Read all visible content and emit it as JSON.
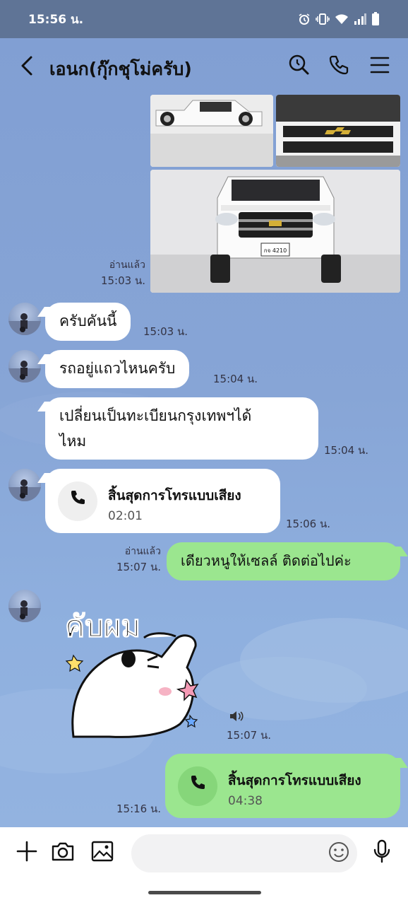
{
  "status_bar": {
    "time": "15:56 น."
  },
  "header": {
    "title": "เอนก(กุ๊กชุโม่ครับ)"
  },
  "messages": {
    "photos_read": "อ่านแล้ว",
    "photos_time": "15:03 น.",
    "plate_text": "กจ 4210",
    "msg1_text": "ครับคันนี้",
    "msg1_time": "15:03 น.",
    "msg2_text": "รถอยู่แถวไหนครับ",
    "msg2_time": "15:04 น.",
    "msg3_line1": "เปลี่ยนเป็นทะเบียนกรุงเทพฯได้",
    "msg3_line2": "ไหม",
    "msg3_time": "15:04 น.",
    "call1_title": "สิ้นสุดการโทรแบบเสียง",
    "call1_duration": "02:01",
    "call1_time": "15:06 น.",
    "reply_read": "อ่านแล้ว",
    "reply_time": "15:07 น.",
    "reply_text": "เดียวหนูให้เซลล์ ติดต่อไปค่ะ",
    "sticker_text": "คับผม",
    "sticker_time": "15:07 น.",
    "call2_title": "สิ้นสุดการโทรแบบเสียง",
    "call2_duration": "04:38",
    "call2_time": "15:16 น."
  },
  "colors": {
    "accent_green": "#9be68f",
    "chat_background": "#87a5d6",
    "status_bar": "#5f7496"
  },
  "icons": {
    "back": "back-arrow-icon",
    "search": "search-icon",
    "phone": "phone-icon",
    "menu": "menu-icon",
    "plus": "plus-icon",
    "camera": "camera-icon",
    "image": "image-icon",
    "emoji": "emoji-icon",
    "mic": "mic-icon"
  }
}
